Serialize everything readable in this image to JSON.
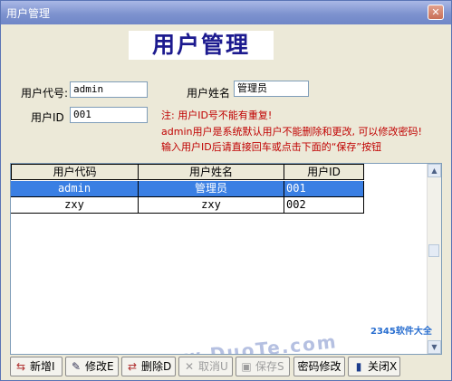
{
  "window": {
    "title": "用户管理",
    "close_label": "✕"
  },
  "heading": "用户管理",
  "form": {
    "user_code_label": "用户代号:",
    "user_code_value": "admin",
    "user_name_label": "用户姓名",
    "user_name_value": "管理员",
    "user_id_label": "用户ID",
    "user_id_value": "001"
  },
  "notes": [
    "注: 用户ID号不能有重复!",
    "admin用户是系统默认用户不能删除和更改, 可以修改密码!",
    "输入用户ID后请直接回车或点击下面的“保存”按钮"
  ],
  "table": {
    "columns": [
      "用户代码",
      "用户姓名",
      "用户ID"
    ],
    "rows": [
      {
        "code": "admin",
        "name": "管理员",
        "id": "001",
        "selected": true
      },
      {
        "code": "zxy",
        "name": "zxy",
        "id": "002",
        "selected": false
      }
    ]
  },
  "toolbar": {
    "buttons": [
      {
        "label": "新增I",
        "icon": "add-icon",
        "glyph": "⇆",
        "enabled": true
      },
      {
        "label": "修改E",
        "icon": "edit-icon",
        "glyph": "✎",
        "enabled": true
      },
      {
        "label": "删除D",
        "icon": "delete-icon",
        "glyph": "⇄",
        "enabled": true
      },
      {
        "label": "取消U",
        "icon": "cancel-icon",
        "glyph": "✕",
        "enabled": false
      },
      {
        "label": "保存S",
        "icon": "save-icon",
        "glyph": "▣",
        "enabled": false
      },
      {
        "label": "密码修改",
        "icon": "",
        "glyph": "",
        "enabled": true
      },
      {
        "label": "关闭X",
        "icon": "close-door-icon",
        "glyph": "▮",
        "enabled": true
      }
    ]
  },
  "watermarks": [
    "www.DuoTe.com",
    "2345软件大全"
  ],
  "colors": {
    "accent": "#3a7fe3",
    "heading": "#1c1a8f",
    "note": "#c00000",
    "titlebar": "#7e93cf"
  }
}
